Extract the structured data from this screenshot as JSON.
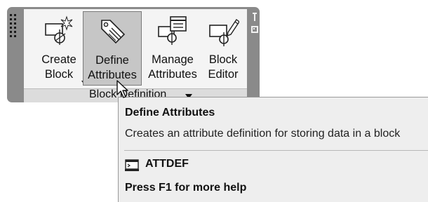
{
  "ribbon_panel": {
    "name": "Block Definition",
    "tools": [
      {
        "id": "create-block",
        "label_line1": "Create",
        "label_line2": "Block",
        "icon": "create-block-icon",
        "has_dropdown": true
      },
      {
        "id": "define-attributes",
        "label_line1": "Define",
        "label_line2": "Attributes",
        "icon": "define-attributes-icon",
        "state": "hover"
      },
      {
        "id": "manage-attributes",
        "label_line1": "Manage",
        "label_line2": "Attributes",
        "icon": "manage-attributes-icon"
      },
      {
        "id": "block-editor",
        "label_line1": "Block",
        "label_line2": "Editor",
        "icon": "block-editor-icon"
      }
    ]
  },
  "tooltip": {
    "title": "Define Attributes",
    "description": "Creates an attribute definition for storing data in a block",
    "command": "ATTDEF",
    "command_icon": "command-line-icon",
    "help": "Press F1 for more help"
  },
  "colors": {
    "panel_frame": "#8a8a8a",
    "panel_body": "#f4f4f4",
    "hover_bg": "#c6c6c6",
    "tooltip_bg": "#eeeeee"
  }
}
